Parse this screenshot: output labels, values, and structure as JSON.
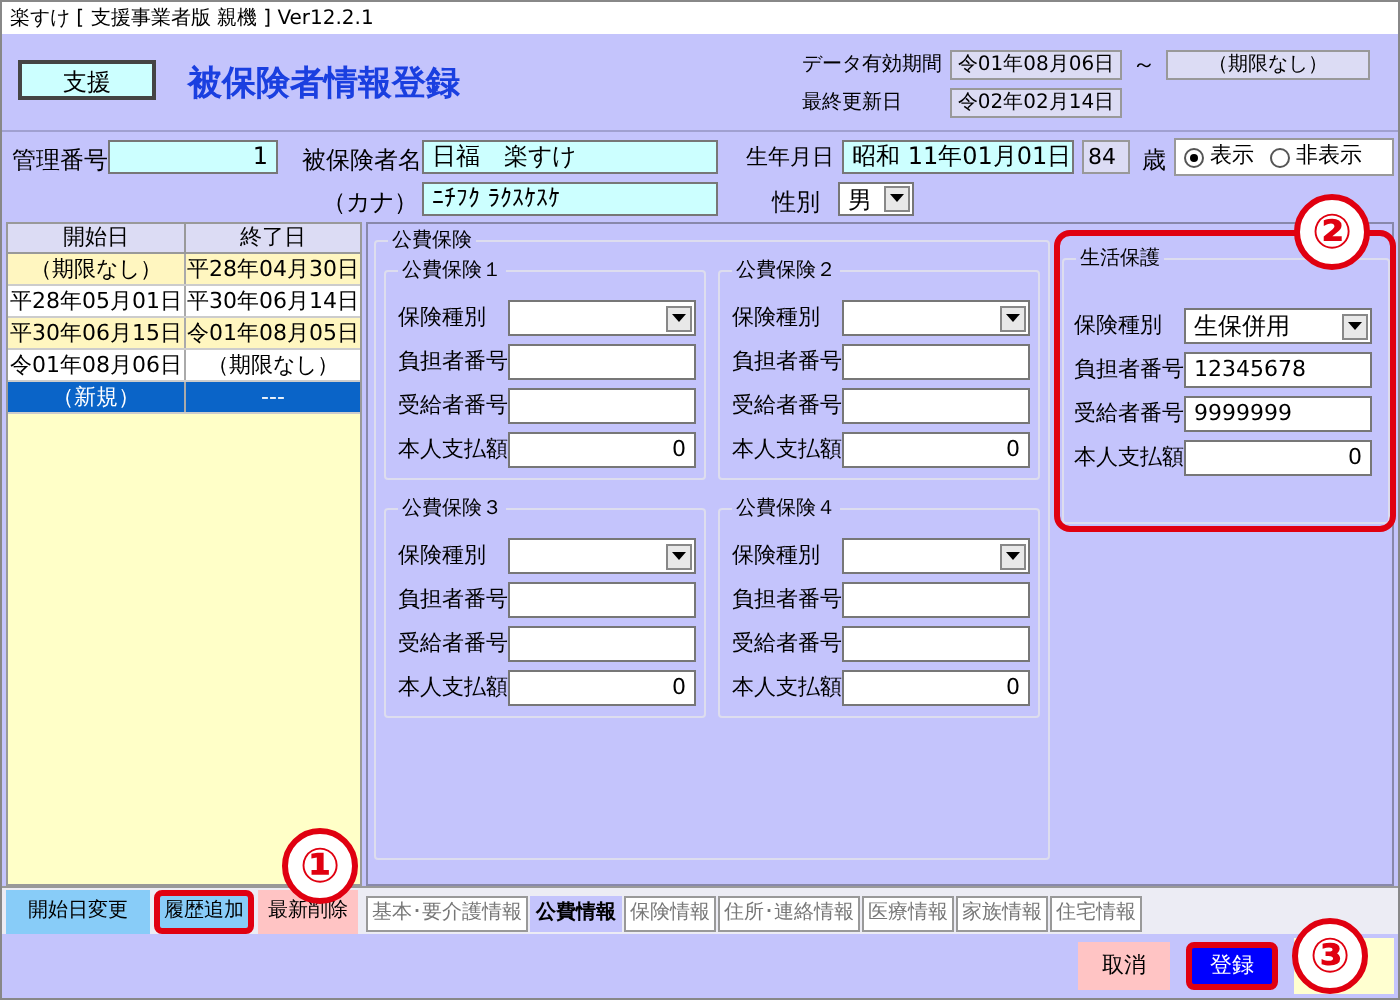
{
  "window": {
    "title": "楽すけ [ 支援事業者版 親機 ] Ver12.2.1"
  },
  "header": {
    "module_button": "支援",
    "title": "被保険者情報登録",
    "validity_label": "データ有効期間",
    "validity_from": "令01年08月06日",
    "tilde": "～",
    "validity_to": "（期限なし）",
    "updated_label": "最終更新日",
    "updated": "令02年02月14日"
  },
  "person": {
    "id_label": "管理番号",
    "id": "1",
    "name_label": "被保険者名",
    "name": "日福　楽すけ",
    "kana_label": "（カナ）",
    "kana": "ﾆﾁﾌｸ ﾗｸｽｹｽｹ",
    "birth_label": "生年月日",
    "birth": "昭和 11年01月01日",
    "age": "84",
    "age_unit": "歳",
    "sex_label": "性別",
    "sex": "男",
    "display_options": [
      {
        "label": "表示",
        "selected": true
      },
      {
        "label": "非表示",
        "selected": false
      }
    ]
  },
  "history": {
    "columns": [
      "開始日",
      "終了日"
    ],
    "rows": [
      {
        "start": "（期限なし）",
        "end": "平28年04月30日",
        "selected": false
      },
      {
        "start": "平28年05月01日",
        "end": "平30年06月14日",
        "selected": false
      },
      {
        "start": "平30年06月15日",
        "end": "令01年08月05日",
        "selected": false
      },
      {
        "start": "令01年08月06日",
        "end": "（期限なし）",
        "selected": false
      },
      {
        "start": "（新規）",
        "end": "---",
        "selected": true
      }
    ]
  },
  "public_insurance": {
    "title": "公費保険",
    "groups": [
      {
        "title": "公費保険１",
        "fields": [
          {
            "label": "保険種別",
            "kind": "select"
          },
          {
            "label": "負担者番号",
            "kind": "text"
          },
          {
            "label": "受給者番号",
            "kind": "text"
          },
          {
            "label": "本人支払額",
            "kind": "number",
            "value": "0"
          }
        ]
      },
      {
        "title": "公費保険２",
        "fields": [
          {
            "label": "保険種別",
            "kind": "select"
          },
          {
            "label": "負担者番号",
            "kind": "text"
          },
          {
            "label": "受給者番号",
            "kind": "text"
          },
          {
            "label": "本人支払額",
            "kind": "number",
            "value": "0"
          }
        ]
      },
      {
        "title": "公費保険３",
        "fields": [
          {
            "label": "保険種別",
            "kind": "select"
          },
          {
            "label": "負担者番号",
            "kind": "text"
          },
          {
            "label": "受給者番号",
            "kind": "text"
          },
          {
            "label": "本人支払額",
            "kind": "number",
            "value": "0"
          }
        ]
      },
      {
        "title": "公費保険４",
        "fields": [
          {
            "label": "保険種別",
            "kind": "select"
          },
          {
            "label": "負担者番号",
            "kind": "text"
          },
          {
            "label": "受給者番号",
            "kind": "text"
          },
          {
            "label": "本人支払額",
            "kind": "number",
            "value": "0"
          }
        ]
      }
    ]
  },
  "livelihood": {
    "title": "生活保護",
    "highlighted": true,
    "fields": [
      {
        "label": "保険種別",
        "kind": "select",
        "value": "生保併用"
      },
      {
        "label": "負担者番号",
        "kind": "text",
        "value": "12345678"
      },
      {
        "label": "受給者番号",
        "kind": "text",
        "value": "9999999"
      },
      {
        "label": "本人支払額",
        "kind": "number",
        "value": "0"
      }
    ]
  },
  "history_buttons": [
    {
      "label": "開始日変更",
      "kind": "normal",
      "highlighted": false
    },
    {
      "label": "履歴追加",
      "kind": "normal",
      "highlighted": true
    },
    {
      "label": "最新削除",
      "kind": "danger",
      "highlighted": false
    }
  ],
  "tabs": [
    {
      "label": "基本･要介護情報",
      "selected": false
    },
    {
      "label": "公費情報",
      "selected": true
    },
    {
      "label": "保険情報",
      "selected": false
    },
    {
      "label": "住所･連絡情報",
      "selected": false
    },
    {
      "label": "医療情報",
      "selected": false
    },
    {
      "label": "家族情報",
      "selected": false
    },
    {
      "label": "住宅情報",
      "selected": false
    }
  ],
  "footer_buttons": [
    {
      "label": "取消",
      "kind": "cancel",
      "highlighted": false
    },
    {
      "label": "登録",
      "kind": "primary",
      "highlighted": true
    }
  ],
  "callouts": [
    {
      "label": "①"
    },
    {
      "label": "②"
    },
    {
      "label": "③"
    }
  ]
}
